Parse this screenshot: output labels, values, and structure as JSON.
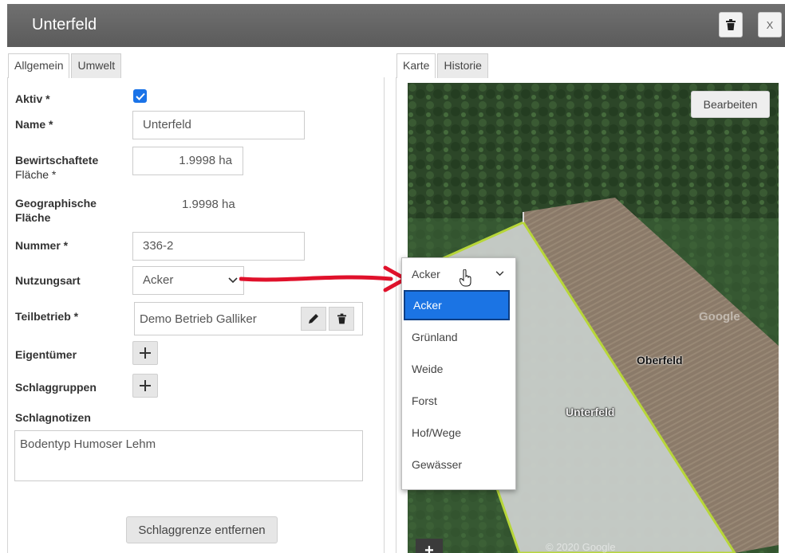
{
  "window": {
    "title": "Unterfeld",
    "close_label": "X"
  },
  "left_tabs": [
    {
      "label": "Allgemein",
      "active": true
    },
    {
      "label": "Umwelt",
      "active": false
    }
  ],
  "form": {
    "aktiv": {
      "label": "Aktiv *",
      "checked": true
    },
    "name": {
      "label": "Name *",
      "value": "Unterfeld"
    },
    "bewirtschaftete": {
      "label_line1": "Bewirtschaftete",
      "label_line2": "Fläche *",
      "value": "1.9998 ha"
    },
    "geographische": {
      "label_line1": "Geographische",
      "label_line2": "Fläche",
      "value": "1.9998 ha"
    },
    "nummer": {
      "label": "Nummer *",
      "value": "336-2"
    },
    "nutzungsart": {
      "label": "Nutzungsart",
      "value": "Acker"
    },
    "teilbetrieb": {
      "label": "Teilbetrieb *",
      "value": "Demo Betrieb Galliker"
    },
    "eigentuemer": {
      "label": "Eigentümer"
    },
    "schlaggruppen": {
      "label": "Schlaggruppen"
    },
    "schlagnotizen": {
      "label": "Schlagnotizen",
      "value": "Bodentyp Humoser Lehm"
    },
    "remove_button": "Schlaggrenze entfernen"
  },
  "right_tabs": [
    {
      "label": "Karte",
      "active": true
    },
    {
      "label": "Historie",
      "active": false
    }
  ],
  "map": {
    "edit_button": "Bearbeiten",
    "field_labels": [
      "Oberfeld",
      "Unterfeld"
    ],
    "watermark": "Google",
    "copyright": "© 2020 Google",
    "zoom_in": "+"
  },
  "dropdown": {
    "selected": "Acker",
    "options": [
      "Acker",
      "Grünland",
      "Weide",
      "Forst",
      "Hof/Wege",
      "Gewässer"
    ]
  },
  "colors": {
    "titlebar": "#636363",
    "accent": "#1b74e4",
    "annotation_arrow": "#e0112b",
    "field_border": "#b7d639"
  }
}
